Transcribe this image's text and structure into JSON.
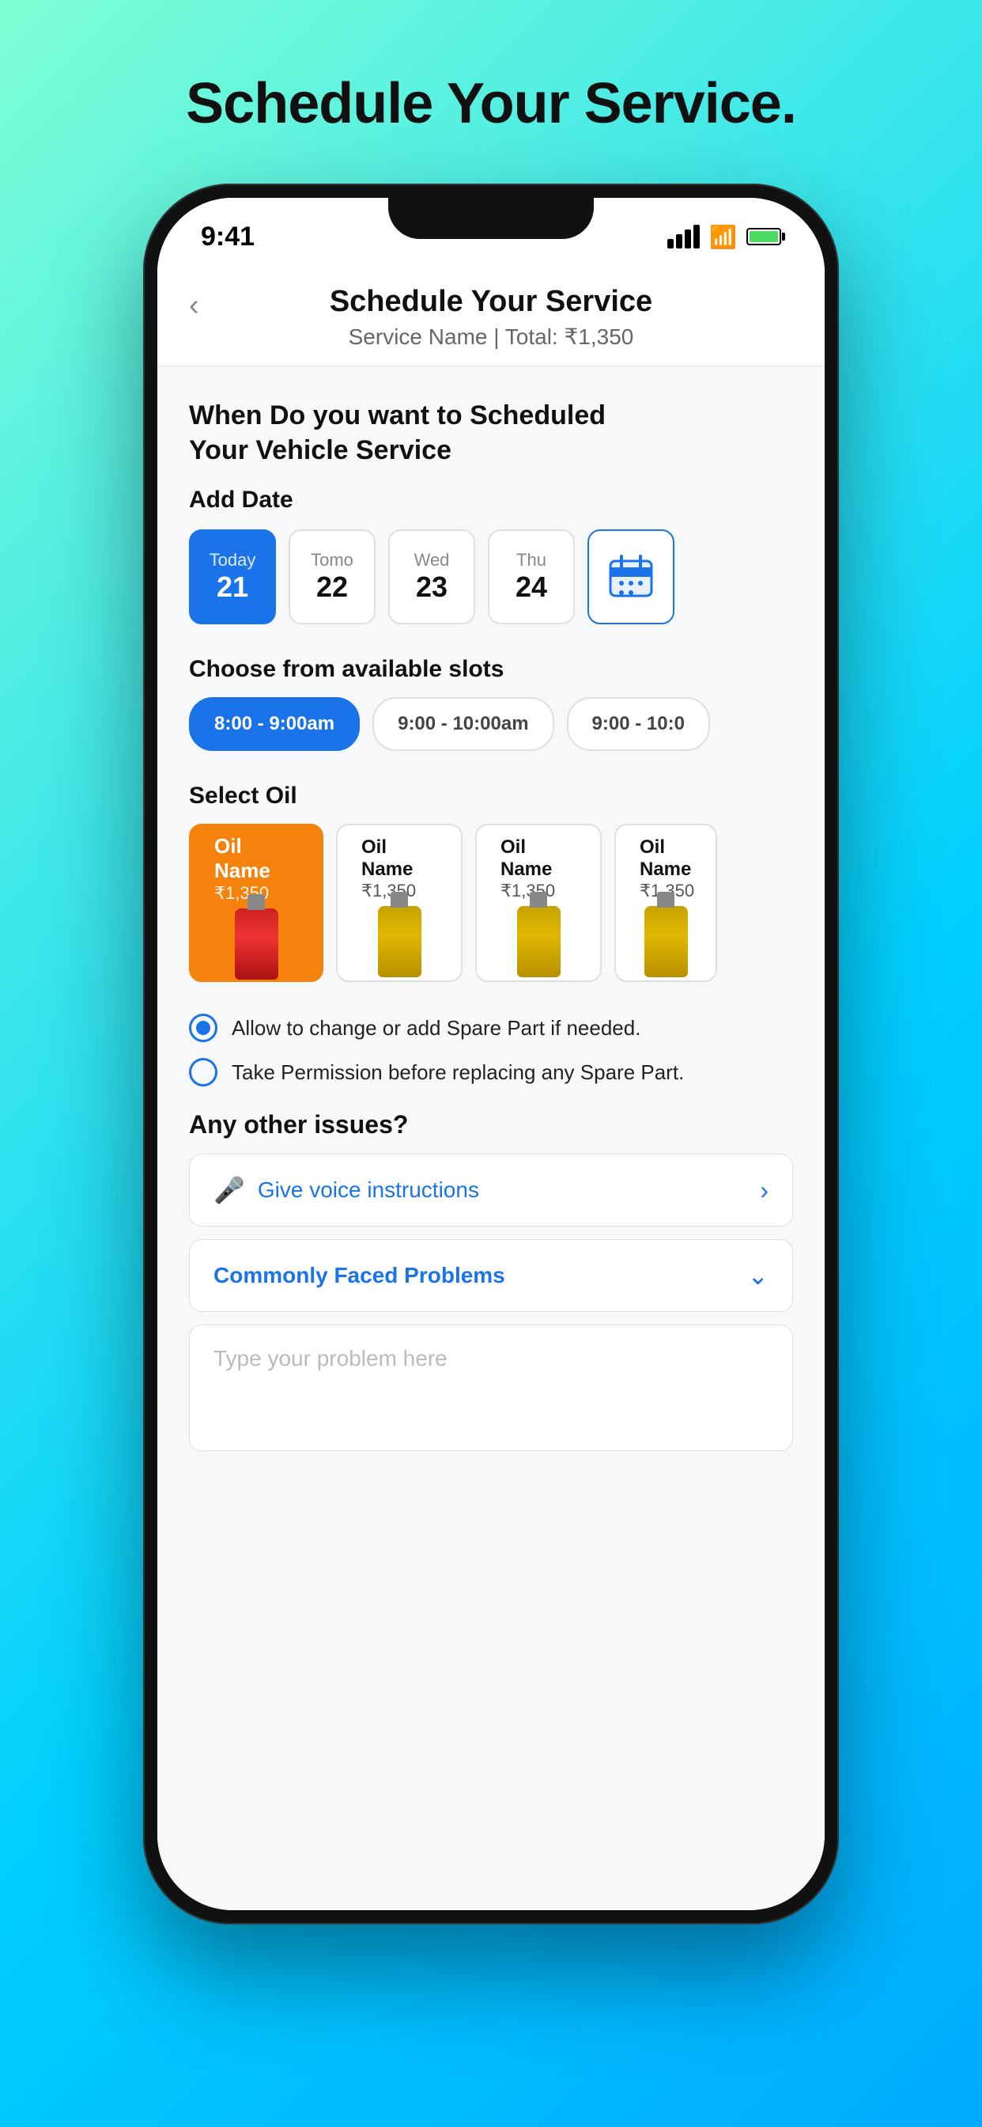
{
  "page": {
    "background_title": "Schedule Your Service.",
    "status_bar": {
      "time": "9:41",
      "signal": "signal-icon",
      "wifi": "wifi-icon",
      "battery": "battery-icon"
    },
    "header": {
      "back_label": "‹",
      "title": "Schedule Your Service",
      "subtitle": "Service Name  |  Total: ₹1,350"
    },
    "when_section_title": "When Do you want to Scheduled\nYour Vehicle Service",
    "date_section": {
      "label": "Add Date",
      "dates": [
        {
          "day": "Today",
          "num": "21",
          "active": true
        },
        {
          "day": "Tomo",
          "num": "22",
          "active": false
        },
        {
          "day": "Wed",
          "num": "23",
          "active": false
        },
        {
          "day": "Thu",
          "num": "24",
          "active": false
        }
      ],
      "calendar_label": "calendar-icon"
    },
    "slots_section": {
      "label": "Choose from available slots",
      "slots": [
        {
          "label": "8:00 - 9:00am",
          "active": true
        },
        {
          "label": "9:00 - 10:00am",
          "active": false
        },
        {
          "label": "9:00 - 10:0",
          "active": false
        }
      ]
    },
    "oil_section": {
      "label": "Select Oil",
      "oils": [
        {
          "name": "Oil\nName",
          "price": "₹1,350",
          "active": true,
          "bottle_color": "red"
        },
        {
          "name": "Oil\nName",
          "price": "₹1,350",
          "active": false,
          "bottle_color": "gold"
        },
        {
          "name": "Oil\nName",
          "price": "₹1,350",
          "active": false,
          "bottle_color": "gold"
        },
        {
          "name": "Oil\nName",
          "price": "₹1,350",
          "active": false,
          "bottle_color": "gold"
        }
      ]
    },
    "permissions": [
      {
        "text": "Allow to change or add Spare Part if needed.",
        "selected": true
      },
      {
        "text": "Take Permission before replacing any Spare Part.",
        "selected": false
      }
    ],
    "issues_section": {
      "label": "Any other issues?",
      "voice_button_label": "Give voice instructions",
      "commonly_faced_label": "Commonly Faced Problems",
      "problem_placeholder": "Type your problem here"
    }
  }
}
